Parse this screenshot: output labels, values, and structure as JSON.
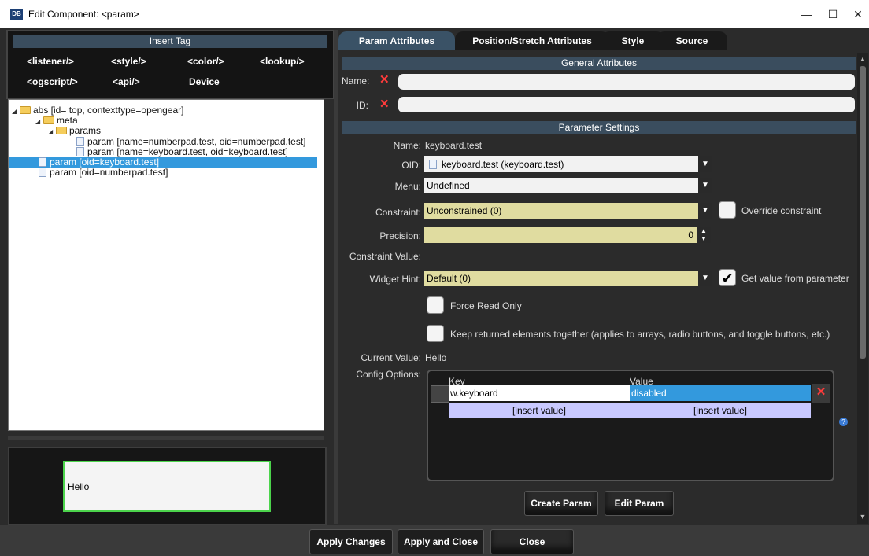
{
  "window": {
    "title": "Edit Component: <param>",
    "app_icon": "app-icon"
  },
  "insert_tag": {
    "title": "Insert Tag",
    "row1": [
      "<listener/>",
      "<style/>",
      "<color/>",
      "<lookup/>"
    ],
    "row2": [
      "<ogscript/>",
      "<api/>",
      "Device"
    ]
  },
  "tree": [
    {
      "label": "abs [id= top, contexttype=opengear]",
      "kind": "folder"
    },
    {
      "label": "meta",
      "kind": "folder"
    },
    {
      "label": "params",
      "kind": "folder"
    },
    {
      "label": "param [name=numberpad.test, oid=numberpad.test]",
      "kind": "doc"
    },
    {
      "label": "param [name=keyboard.test, oid=keyboard.test]",
      "kind": "doc"
    },
    {
      "label": "param [oid=keyboard.test]",
      "kind": "doc",
      "selected": true
    },
    {
      "label": "param [oid=numberpad.test]",
      "kind": "doc"
    }
  ],
  "preview": {
    "text": "Hello"
  },
  "tabs": [
    "Param Attributes",
    "Position/Stretch Attributes",
    "Style",
    "Source"
  ],
  "general": {
    "title": "General Attributes",
    "name_label": "Name:",
    "id_label": "ID:",
    "name_value": "",
    "id_value": ""
  },
  "param_settings": {
    "title": "Parameter Settings",
    "name_label": "Name:",
    "name_value": "keyboard.test",
    "oid_label": "OID:",
    "oid_value": "keyboard.test (keyboard.test)",
    "menu_label": "Menu:",
    "menu_value": "Undefined",
    "constraint_label": "Constraint:",
    "constraint_value": "Unconstrained (0)",
    "override_label": "Override constraint",
    "precision_label": "Precision:",
    "precision_value": "0",
    "constraint_value_label": "Constraint Value:",
    "widget_hint_label": "Widget Hint:",
    "widget_hint_value": "Default (0)",
    "get_value_label": "Get value from parameter",
    "force_ro_label": "Force Read Only",
    "keep_together_label": "Keep returned elements together (applies to arrays, radio buttons, and toggle buttons, etc.)",
    "current_value_label": "Current Value:",
    "current_value": "Hello",
    "config_label": "Config Options:"
  },
  "config_table": {
    "headers": [
      "Key",
      "Value"
    ],
    "rows": [
      {
        "key": "w.keyboard",
        "value": "disabled"
      }
    ],
    "insert_key": "[insert value]",
    "insert_value": "[insert value]"
  },
  "buttons": {
    "create_param": "Create Param",
    "edit_param": "Edit Param"
  },
  "footer": {
    "apply_changes": "Apply Changes",
    "apply_close": "Apply and Close",
    "close": "Close"
  },
  "colors": {
    "accent": "#3399dd",
    "section_bar": "#3a4d5e",
    "combo_bg": "#e0dca0",
    "insert_row": "#c8c8ff",
    "preview_border": "#4cd44c"
  }
}
